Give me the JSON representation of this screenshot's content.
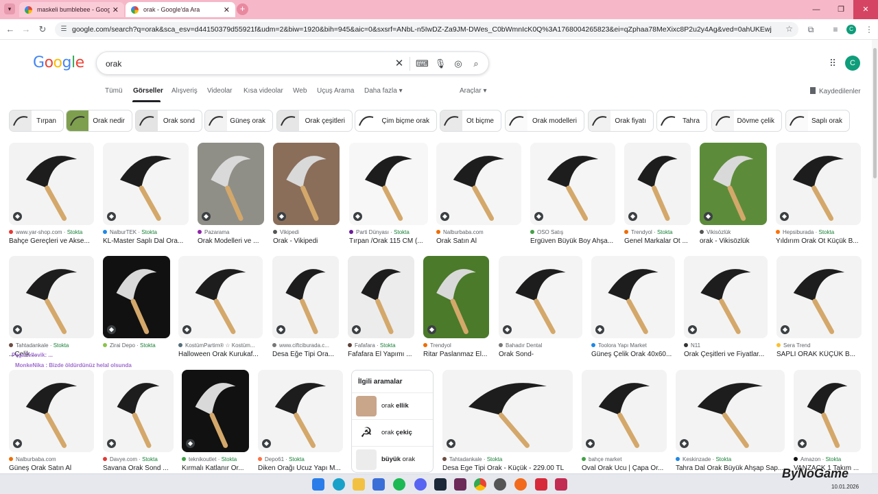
{
  "browser": {
    "tabs": [
      {
        "title": "maskeli bumblebee - Google'da"
      },
      {
        "title": "orak - Google'da Ara"
      }
    ],
    "url": "google.com/search?q=orak&sca_esv=d44150379d55921f&udm=2&biw=1920&bih=945&aic=0&sxsrf=ANbL-n5IwDZ-Za9JM-DWes_C0bWmnIcK0Q%3A1768004265823&ei=qZphaa78MeXixc8P2u2y4Ag&ved=0ahUKEwju9OaR2f-RAxVIcfEDHdq2DIw...",
    "profile_initial": "C"
  },
  "google": {
    "logo": [
      "G",
      "o",
      "o",
      "g",
      "l",
      "e"
    ],
    "query": "orak",
    "avatar": "C",
    "tabs": [
      "Tümü",
      "Görseller",
      "Alışveriş",
      "Videolar",
      "Kısa videolar",
      "Web",
      "Uçuş Arama",
      "Daha fazla ▾",
      "Araçlar ▾"
    ],
    "saved": "Kaydedilenler"
  },
  "chips": [
    "Tırpan",
    "Orak nedir",
    "Orak sond",
    "Güneş orak",
    "Orak çeşitleri",
    "Çim biçme orak",
    "Ot biçme",
    "Orak modelleri",
    "Orak fiyatı",
    "Tahra",
    "Dövme çelik",
    "Saplı orak"
  ],
  "results": [
    {
      "src": "www.yar-shop.com",
      "stock": "Stokta",
      "title": "Bahçe Gereçleri ve Akse..."
    },
    {
      "src": "NalburTEK",
      "stock": "Stokta",
      "title": "KL-Master Saplı Dal Ora..."
    },
    {
      "src": "Pazarama",
      "stock": "",
      "title": "Orak Modelleri ve ..."
    },
    {
      "src": "Vikipedi",
      "stock": "",
      "title": "Orak - Vikipedi"
    },
    {
      "src": "Parti Dünyası",
      "stock": "Stokta",
      "title": "Tırpan /Orak 115 CM (..."
    },
    {
      "src": "Nalburbaba.com",
      "stock": "",
      "title": "Orak Satın Al"
    },
    {
      "src": "OSO Satış",
      "stock": "",
      "title": "Ergüven Büyük Boy Ahşa..."
    },
    {
      "src": "Trendyol",
      "stock": "Stokta",
      "title": "Genel Markalar Ot ..."
    },
    {
      "src": "Vikisözlük",
      "stock": "",
      "title": "orak - Vikisözlük"
    },
    {
      "src": "Hepsiburada",
      "stock": "Stokta",
      "title": "Yıldırım Orak Ot Küçük B..."
    },
    {
      "src": "Tahtadankale",
      "stock": "Stokta",
      "title": "...Çelik ..."
    },
    {
      "src": "Zirai Depo",
      "stock": "Stokta",
      "title": ""
    },
    {
      "src": "KostümPartim® ☆ Kostüm...",
      "stock": "",
      "title": "Halloween Orak Kurukaf..."
    },
    {
      "src": "www.ciftciburada.c...",
      "stock": "",
      "title": "Desa Eğe Tipi Ora..."
    },
    {
      "src": "Fafafara",
      "stock": "Stokta",
      "title": "Fafafara El Yapımı ..."
    },
    {
      "src": "Trendyol",
      "stock": "",
      "title": "Ritar Paslanmaz El..."
    },
    {
      "src": "Bahadır Dental",
      "stock": "",
      "title": "Orak Sond-"
    },
    {
      "src": "Toolora Yapı Market",
      "stock": "",
      "title": "Güneş Çelik Orak 40x60..."
    },
    {
      "src": "N11",
      "stock": "",
      "title": "Orak Çeşitleri ve Fiyatlar..."
    },
    {
      "src": "Sera Trend",
      "stock": "",
      "title": "SAPLI ORAK KÜÇÜK B..."
    },
    {
      "src": "Nalburbaba.com",
      "stock": "",
      "title": "Güneş Orak Satın Al"
    },
    {
      "src": "Davye.com",
      "stock": "Stokta",
      "title": "Savana Orak Sond ..."
    },
    {
      "src": "teknikoutlet",
      "stock": "Stokta",
      "title": "Kırmalı Katlanır Or..."
    },
    {
      "src": "Depo61",
      "stock": "Stokta",
      "title": "Diken Orağı Ucuz Yapı M..."
    },
    {
      "src": "Tahtadankale",
      "stock": "Stokta",
      "title": "Desa Ege Tipi Orak - Küçük - 229.00 TL"
    },
    {
      "src": "bahçe market",
      "stock": "",
      "title": "Oval Orak Ucu | Çapa Or..."
    },
    {
      "src": "Keskinzade",
      "stock": "Stokta",
      "title": "Tahra Dal Orak Büyük Ahşap Sap..."
    },
    {
      "src": "Amazon",
      "stock": "Stokta",
      "title": "VANZACK 1 Takım ..."
    }
  ],
  "related": {
    "heading": "İlgili aramalar",
    "items": [
      {
        "prefix": "orak ",
        "bold": "ellik",
        "suffix": ""
      },
      {
        "prefix": "orak ",
        "bold": "çekiç",
        "suffix": ""
      },
      {
        "prefix": "",
        "bold": "büyük",
        "suffix": " orak"
      }
    ]
  },
  "overlays": [
    "PegaZellevik: ...",
    "MonkeNika : Bizde öldürdünüz helal olsunda"
  ],
  "taskbar": {
    "date": "10.01.2026"
  },
  "watermark": "ByNoGame",
  "colors": {
    "tab_strip": "#f6b8c8",
    "stokta": "#188038",
    "link_gray": "#5f6368"
  }
}
